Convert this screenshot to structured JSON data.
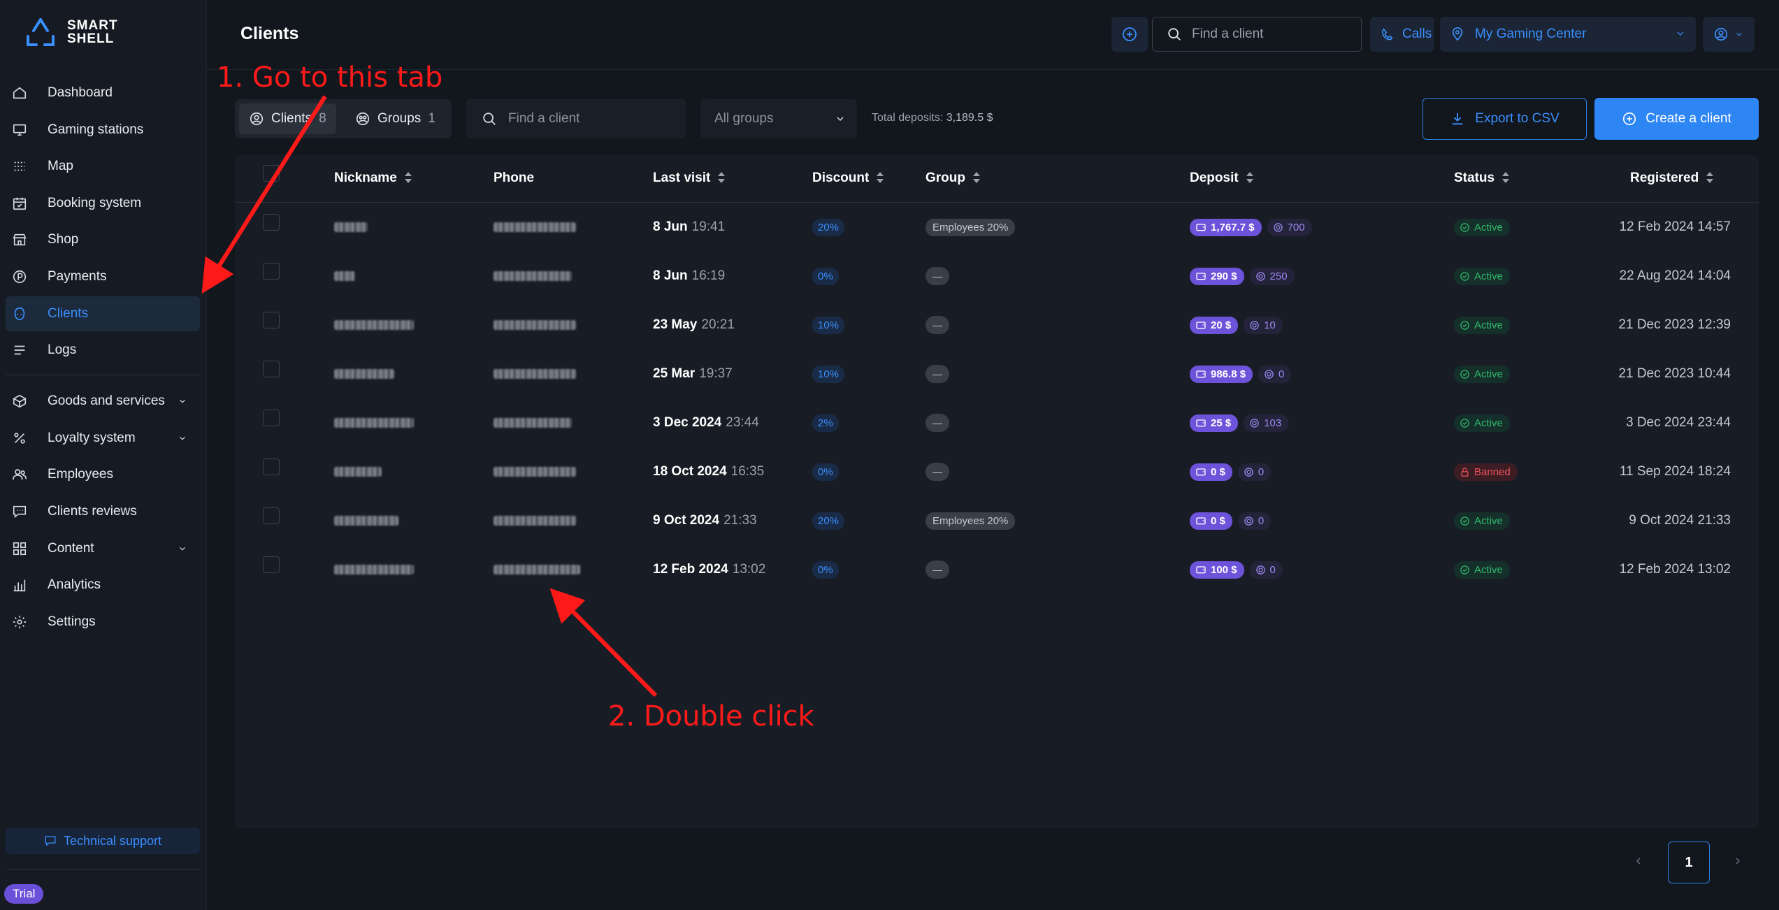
{
  "brand": {
    "line1": "SMART",
    "line2": "SHELL"
  },
  "sidebar": {
    "items": [
      {
        "label": "Dashboard",
        "icon": "home-icon"
      },
      {
        "label": "Gaming stations",
        "icon": "monitor-icon"
      },
      {
        "label": "Map",
        "icon": "grid-dots-icon"
      },
      {
        "label": "Booking system",
        "icon": "calendar-icon"
      },
      {
        "label": "Shop",
        "icon": "store-icon"
      },
      {
        "label": "Payments",
        "icon": "coin-icon"
      },
      {
        "label": "Clients",
        "icon": "client-icon",
        "active": true
      },
      {
        "label": "Logs",
        "icon": "list-icon"
      }
    ],
    "items2": [
      {
        "label": "Goods and services",
        "icon": "box-icon",
        "expandable": true
      },
      {
        "label": "Loyalty system",
        "icon": "percent-icon",
        "expandable": true
      },
      {
        "label": "Employees",
        "icon": "users-icon"
      },
      {
        "label": "Clients reviews",
        "icon": "message-icon"
      },
      {
        "label": "Content",
        "icon": "layout-icon",
        "expandable": true
      },
      {
        "label": "Analytics",
        "icon": "bar-chart-icon"
      },
      {
        "label": "Settings",
        "icon": "gear-icon"
      }
    ],
    "support_label": "Technical support",
    "trial_label": "Trial"
  },
  "header": {
    "title": "Clients",
    "search_placeholder": "Find a client",
    "calls_label": "Calls",
    "center_label": "My Gaming Center"
  },
  "toolbar": {
    "tab_clients_label": "Clients",
    "tab_clients_count": "8",
    "tab_groups_label": "Groups",
    "tab_groups_count": "1",
    "search_placeholder": "Find a client",
    "groups_select": "All groups",
    "total_label": "Total deposits:",
    "total_value": "3,189.5 $",
    "export_label": "Export to CSV",
    "create_label": "Create a client"
  },
  "table": {
    "columns": {
      "nickname": "Nickname",
      "phone": "Phone",
      "last_visit": "Last visit",
      "discount": "Discount",
      "group": "Group",
      "deposit": "Deposit",
      "status": "Status",
      "registered": "Registered"
    },
    "rows": [
      {
        "visit_date": "8 Jun",
        "visit_time": "19:41",
        "discount": "20%",
        "group": "Employees 20%",
        "deposit": "1,767.7 $",
        "bonus": "700",
        "status": "Active",
        "registered": "12 Feb 2024 14:57"
      },
      {
        "visit_date": "8 Jun",
        "visit_time": "16:19",
        "discount": "0%",
        "group": "—",
        "deposit": "290 $",
        "bonus": "250",
        "status": "Active",
        "registered": "22 Aug 2024 14:04"
      },
      {
        "visit_date": "23 May",
        "visit_time": "20:21",
        "discount": "10%",
        "group": "—",
        "deposit": "20 $",
        "bonus": "10",
        "status": "Active",
        "registered": "21 Dec 2023 12:39"
      },
      {
        "visit_date": "25 Mar",
        "visit_time": "19:37",
        "discount": "10%",
        "group": "—",
        "deposit": "986.8 $",
        "bonus": "0",
        "status": "Active",
        "registered": "21 Dec 2023 10:44"
      },
      {
        "visit_date": "3 Dec 2024",
        "visit_time": "23:44",
        "discount": "2%",
        "group": "—",
        "deposit": "25 $",
        "bonus": "103",
        "status": "Active",
        "registered": "3 Dec 2024 23:44"
      },
      {
        "visit_date": "18 Oct 2024",
        "visit_time": "16:35",
        "discount": "0%",
        "group": "—",
        "deposit": "0 $",
        "bonus": "0",
        "status": "Banned",
        "registered": "11 Sep 2024 18:24"
      },
      {
        "visit_date": "9 Oct 2024",
        "visit_time": "21:33",
        "discount": "20%",
        "group": "Employees 20%",
        "deposit": "0 $",
        "bonus": "0",
        "status": "Active",
        "registered": "9 Oct 2024 21:33"
      },
      {
        "visit_date": "12 Feb 2024",
        "visit_time": "13:02",
        "discount": "0%",
        "group": "—",
        "deposit": "100 $",
        "bonus": "0",
        "status": "Active",
        "registered": "12 Feb 2024 13:02"
      }
    ]
  },
  "pagination": {
    "current": "1"
  },
  "annotations": {
    "step1": "1. Go to this tab",
    "step2": "2. Double click",
    "color": "#ff1a1a"
  },
  "colors": {
    "accent": "#2e86f5",
    "deposit": "#6c53d9",
    "active": "#31b96c",
    "banned": "#f0505a"
  }
}
